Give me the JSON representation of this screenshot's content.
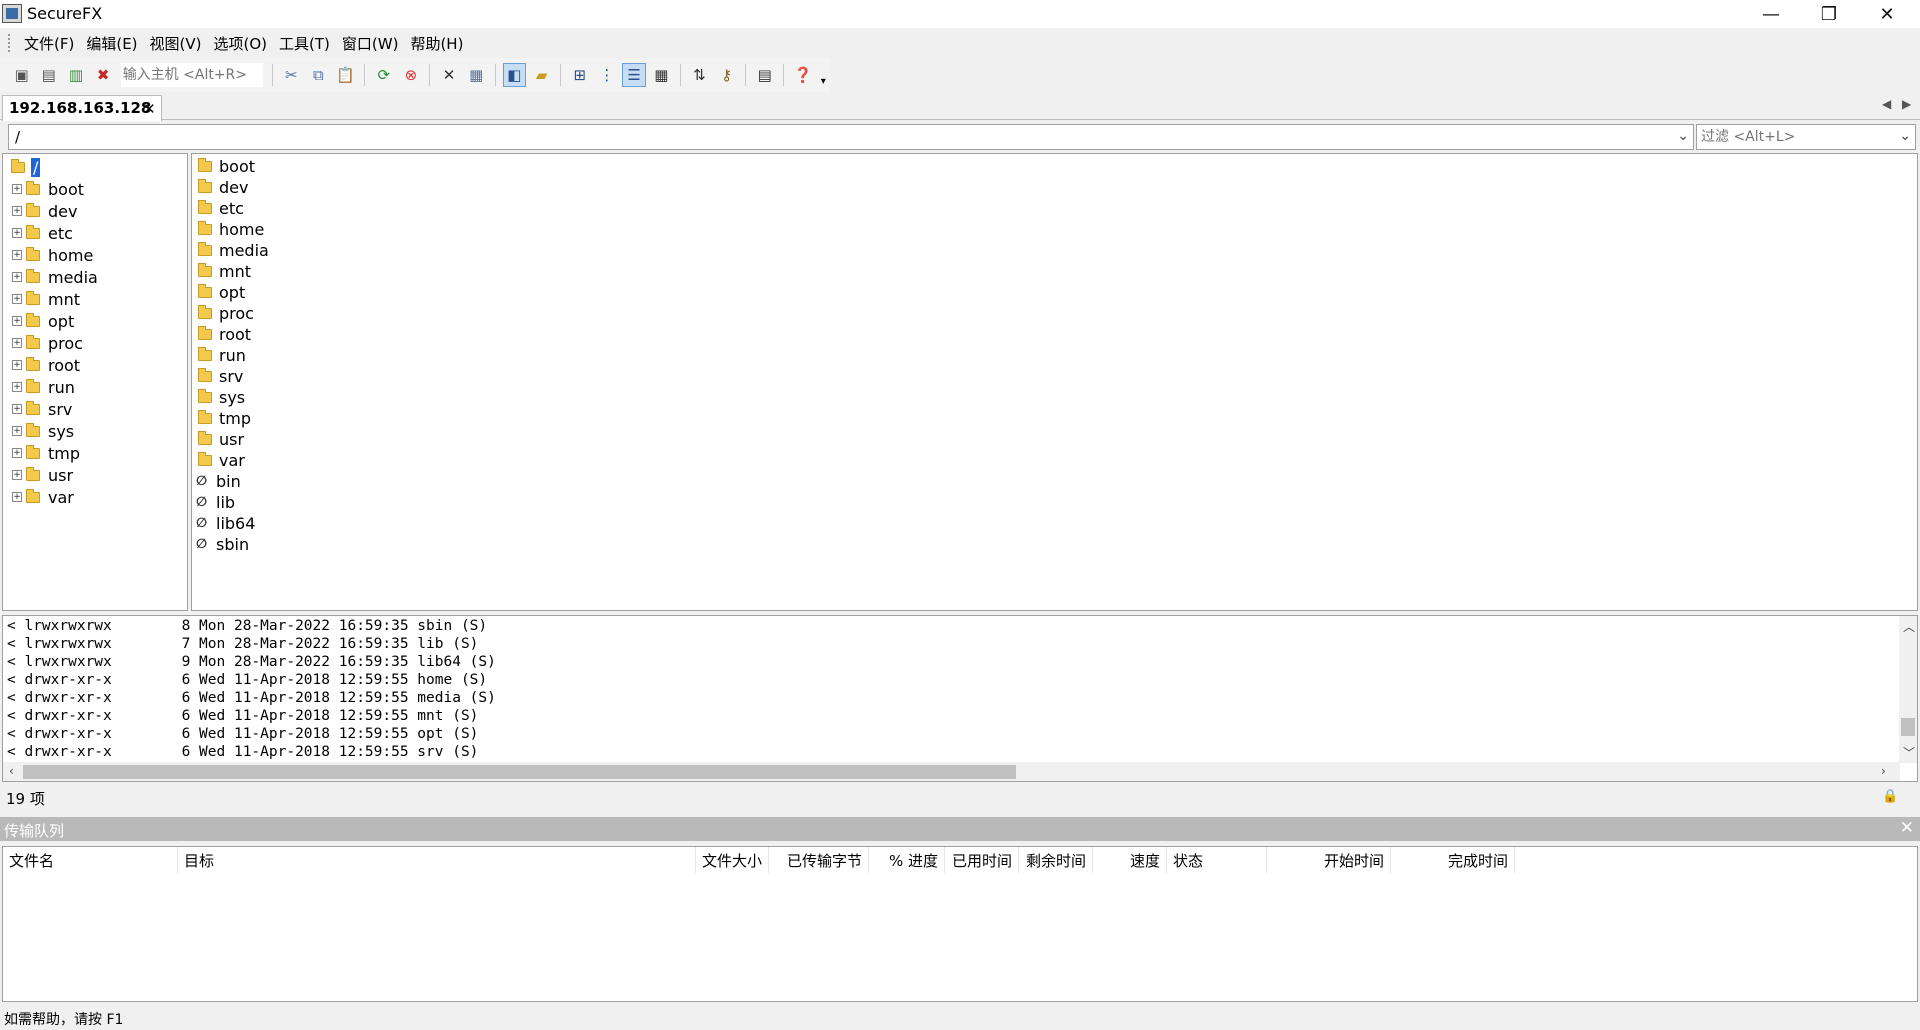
{
  "window": {
    "title": "SecureFX",
    "minimize": "—",
    "restore": "❐",
    "close": "✕"
  },
  "menu": [
    "文件(F)",
    "编辑(E)",
    "视图(V)",
    "选项(O)",
    "工具(T)",
    "窗口(W)",
    "帮助(H)"
  ],
  "toolbar": {
    "host_placeholder": "输入主机 <Alt+R>"
  },
  "tab": {
    "label": "192.168.163.128",
    "close": "✕"
  },
  "pathbar": {
    "path": "/",
    "filter_placeholder": "过滤 <Alt+L>"
  },
  "tree": {
    "root": "/",
    "items": [
      "boot",
      "dev",
      "etc",
      "home",
      "media",
      "mnt",
      "opt",
      "proc",
      "root",
      "run",
      "srv",
      "sys",
      "tmp",
      "usr",
      "var"
    ]
  },
  "files": {
    "folders": [
      "boot",
      "dev",
      "etc",
      "home",
      "media",
      "mnt",
      "opt",
      "proc",
      "root",
      "run",
      "srv",
      "sys",
      "tmp",
      "usr",
      "var"
    ],
    "links": [
      "bin",
      "lib",
      "lib64",
      "sbin"
    ]
  },
  "log": [
    "< lrwxrwxrwx        8 Mon 28-Mar-2022 16:59:35 sbin (S)",
    "< lrwxrwxrwx        7 Mon 28-Mar-2022 16:59:35 lib (S)",
    "< lrwxrwxrwx        9 Mon 28-Mar-2022 16:59:35 lib64 (S)",
    "< drwxr-xr-x        6 Wed 11-Apr-2018 12:59:55 home (S)",
    "< drwxr-xr-x        6 Wed 11-Apr-2018 12:59:55 media (S)",
    "< drwxr-xr-x        6 Wed 11-Apr-2018 12:59:55 mnt (S)",
    "< drwxr-xr-x        6 Wed 11-Apr-2018 12:59:55 opt (S)",
    "< drwxr-xr-x        6 Wed 11-Apr-2018 12:59:55 srv (S)"
  ],
  "item_count": "19 项",
  "queue": {
    "title": "传输队列",
    "close": "✕",
    "columns": [
      "文件名",
      "目标",
      "文件大小",
      "已传输字节",
      "% 进度",
      "已用时间",
      "剩余时间",
      "速度",
      "状态",
      "开始时间",
      "完成时间"
    ]
  },
  "statusbar": "如需帮助，请按 F1",
  "colors": {
    "selection": "#2563d8",
    "folder": "#f2c94c",
    "queue_header": "#b9b9b9"
  }
}
